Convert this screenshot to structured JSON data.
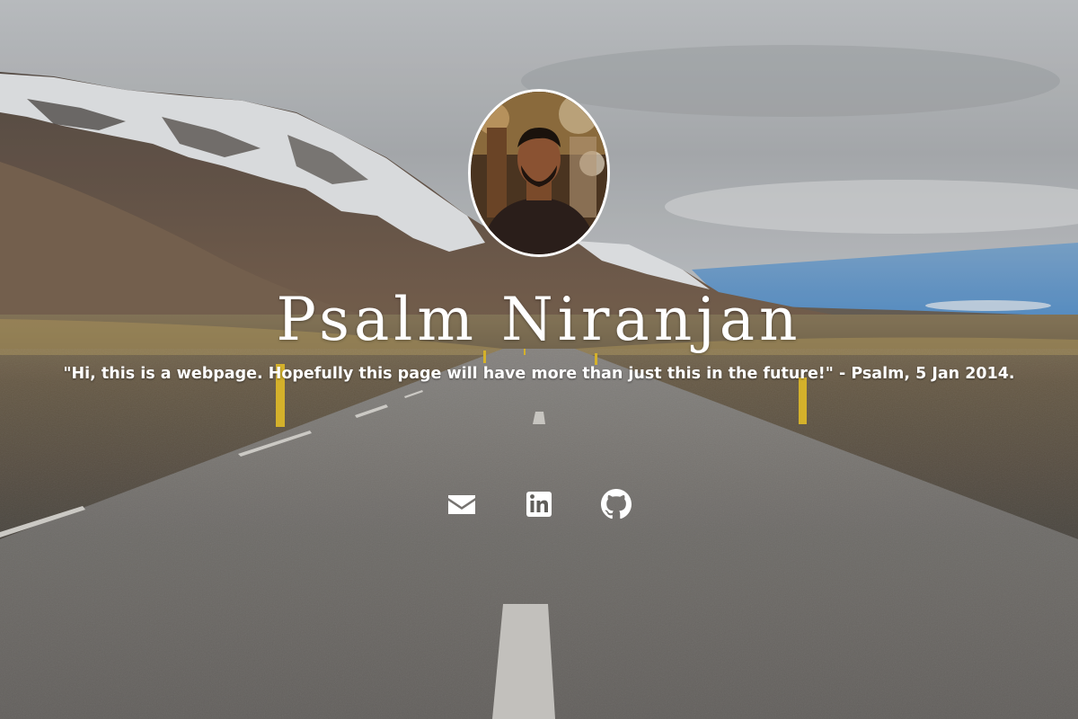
{
  "profile": {
    "name": "Psalm Niranjan",
    "quote": "\"Hi, this is a webpage. Hopefully this page will have more than just this in the future!\" - Psalm, 5 Jan 2014."
  },
  "social": {
    "links": [
      {
        "icon": "envelope-icon"
      },
      {
        "icon": "linkedin-icon"
      },
      {
        "icon": "github-icon"
      }
    ]
  },
  "colors": {
    "text": "#ffffff",
    "sky": "#b8bcc0",
    "road": "#6e6c69",
    "marker": "#e8c234"
  }
}
